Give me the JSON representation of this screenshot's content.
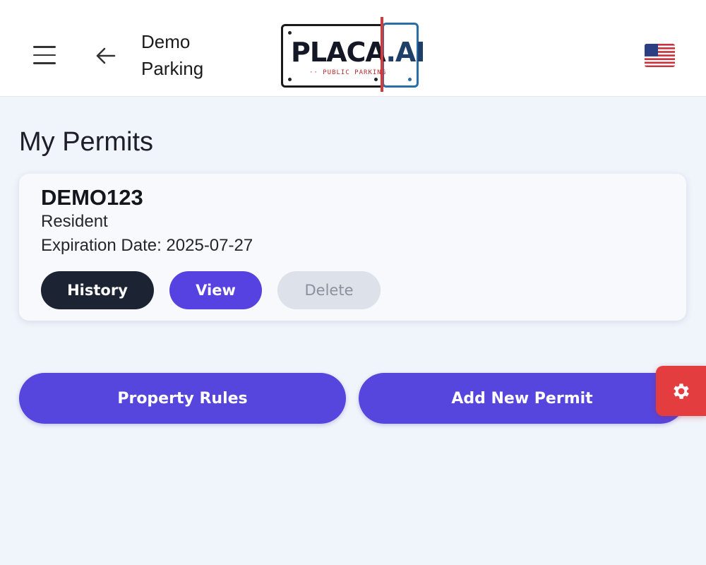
{
  "header": {
    "title": "Demo Parking",
    "logo_text": "PLACA",
    "logo_text_suffix": ".AI",
    "logo_subtext": "·· PUBLIC PARKING",
    "language_flag": "us-flag-icon"
  },
  "page": {
    "title": "My Permits"
  },
  "permits": [
    {
      "plate": "DEMO123",
      "type": "Resident",
      "expiration": "Expiration Date: 2025-07-27",
      "history_label": "History",
      "view_label": "View",
      "delete_label": "Delete"
    }
  ],
  "actions": {
    "property_rules_label": "Property Rules",
    "add_permit_label": "Add New Permit"
  },
  "colors": {
    "accent": "#5646dd",
    "dark": "#1c2434",
    "disabled": "#dce1ea",
    "fab": "#e33d3f",
    "background": "#f0f4fb"
  }
}
